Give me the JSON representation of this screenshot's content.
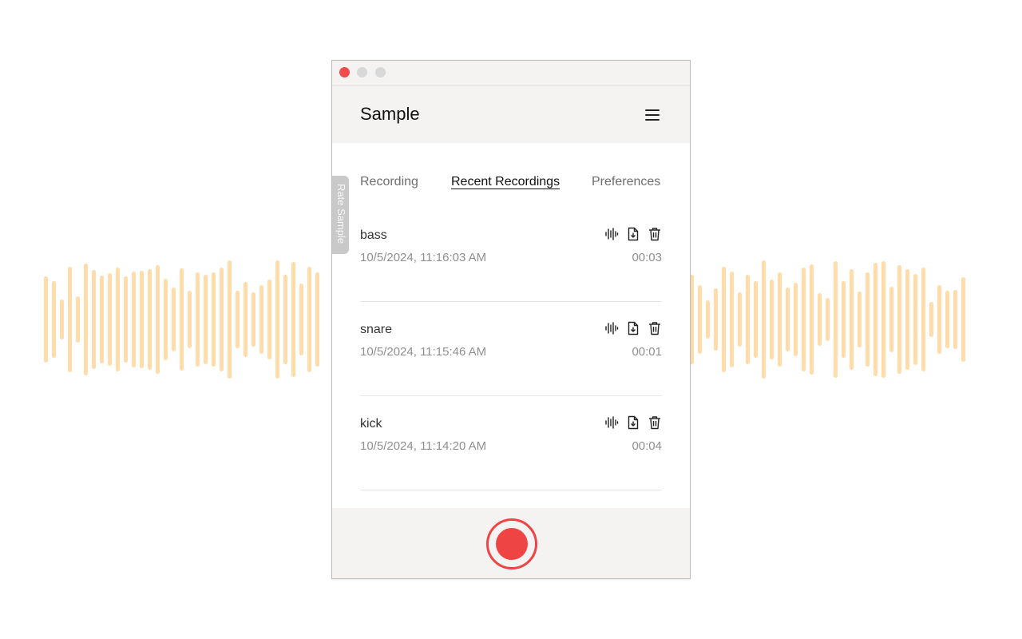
{
  "app": {
    "title": "Sample"
  },
  "side_tab": {
    "label": "Rate Sample"
  },
  "tabs": [
    {
      "label": "Recording",
      "active": false
    },
    {
      "label": "Recent Recordings",
      "active": true
    },
    {
      "label": "Preferences",
      "active": false
    }
  ],
  "recordings": [
    {
      "name": "bass",
      "date": "10/5/2024, 11:16:03 AM",
      "duration": "00:03"
    },
    {
      "name": "snare",
      "date": "10/5/2024, 11:15:46 AM",
      "duration": "00:01"
    },
    {
      "name": "kick",
      "date": "10/5/2024, 11:14:20 AM",
      "duration": "00:04"
    }
  ],
  "item_icons": [
    "waveform-icon",
    "download-file-icon",
    "trash-icon"
  ],
  "colors": {
    "accent_red": "#ef4444",
    "wave_orange": "#ffdcaa",
    "header_bg": "#f4f3f1"
  }
}
